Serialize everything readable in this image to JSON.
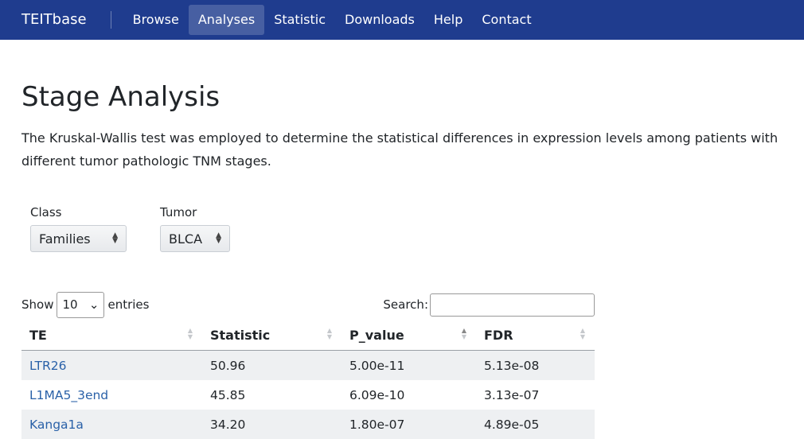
{
  "nav": {
    "brand": "TEITbase",
    "items": [
      "Browse",
      "Analyses",
      "Statistic",
      "Downloads",
      "Help",
      "Contact"
    ],
    "active": "Analyses"
  },
  "page": {
    "title": "Stage Analysis",
    "description": "The Kruskal-Wallis test was employed to determine the statistical differences in expression levels among patients with different tumor pathologic TNM stages."
  },
  "filters": {
    "class_label": "Class",
    "class_value": "Families",
    "tumor_label": "Tumor",
    "tumor_value": "BLCA"
  },
  "table_controls": {
    "show_label": "Show",
    "page_length": "10",
    "entries_label": "entries",
    "search_label": "Search:"
  },
  "table": {
    "columns": [
      "TE",
      "Statistic",
      "P_value",
      "FDR"
    ],
    "rows": [
      [
        "LTR26",
        "50.96",
        "5.00e-11",
        "5.13e-08"
      ],
      [
        "L1MA5_3end",
        "45.85",
        "6.09e-10",
        "3.13e-07"
      ],
      [
        "Kanga1a",
        "34.20",
        "1.80e-07",
        "4.89e-05"
      ]
    ]
  }
}
